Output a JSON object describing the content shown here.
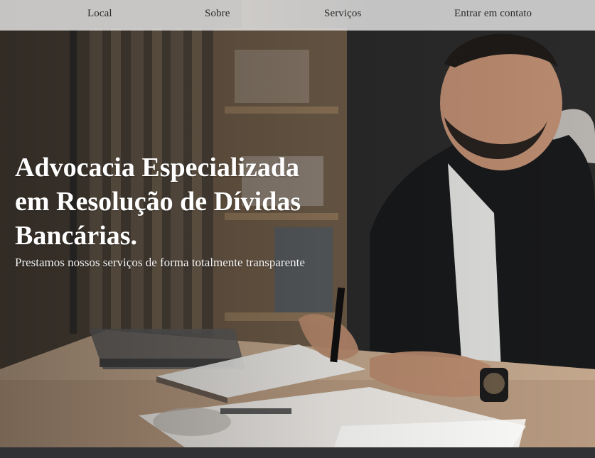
{
  "nav": {
    "items": [
      {
        "label": "Local"
      },
      {
        "label": "Sobre"
      },
      {
        "label": "Serviços"
      },
      {
        "label": "Entrar em contato"
      }
    ]
  },
  "hero": {
    "title": "Advocacia Especializada em Resolução de Dívidas Bancárias.",
    "subtitle": "Prestamos nossos serviços de forma totalmente transparente",
    "image_subject": "lawyer-writing-at-desk-photo"
  },
  "colors": {
    "nav_background": "#ebebeb",
    "nav_text": "#2a2a2a",
    "hero_text": "#ffffff",
    "bottom_bar": "#313234"
  }
}
